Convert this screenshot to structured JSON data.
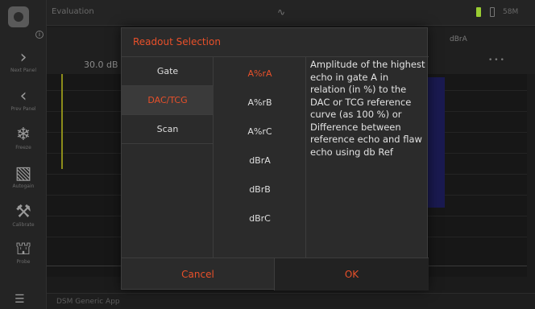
{
  "topbar": {
    "title": "Evaluation",
    "clock": "58M"
  },
  "sidebar": {
    "items": [
      {
        "icon": "chevron-right-icon",
        "glyph": "›",
        "caption": "Next Panel"
      },
      {
        "icon": "chevron-left-icon",
        "glyph": "‹",
        "caption": "Prev Panel"
      },
      {
        "icon": "snowflake-icon",
        "glyph": "❄",
        "caption": "Freeze"
      },
      {
        "icon": "autogain-icon",
        "glyph": "▧",
        "caption": "Autogain"
      },
      {
        "icon": "calibrate-icon",
        "glyph": "⚒",
        "caption": "Calibrate"
      },
      {
        "icon": "probe-icon",
        "glyph": "⛫",
        "caption": "Probe"
      }
    ],
    "menu_glyph": "☰"
  },
  "readout": {
    "gain": "30.0 dB",
    "label": "dBrA",
    "value": "•••"
  },
  "statusbar": {
    "text": "DSM Generic App"
  },
  "dialog": {
    "title": "Readout Selection",
    "categories": [
      {
        "label": "Gate",
        "selected": false
      },
      {
        "label": "DAC/TCG",
        "selected": true
      },
      {
        "label": "Scan",
        "selected": false
      }
    ],
    "options": [
      {
        "label": "A%rA",
        "selected": true
      },
      {
        "label": "A%rB",
        "selected": false
      },
      {
        "label": "A%rC",
        "selected": false
      },
      {
        "label": "dBrA",
        "selected": false
      },
      {
        "label": "dBrB",
        "selected": false
      },
      {
        "label": "dBrC",
        "selected": false
      }
    ],
    "description": "Amplitude of the highest echo in gate A in relation (in %) to the DAC or TCG reference curve (as 100 %) or Difference between reference echo and flaw echo using db Ref",
    "cancel_label": "Cancel",
    "ok_label": "OK"
  },
  "colors": {
    "accent": "#e8502a",
    "background": "#1b1b1b",
    "panel": "#2b2b2b"
  }
}
